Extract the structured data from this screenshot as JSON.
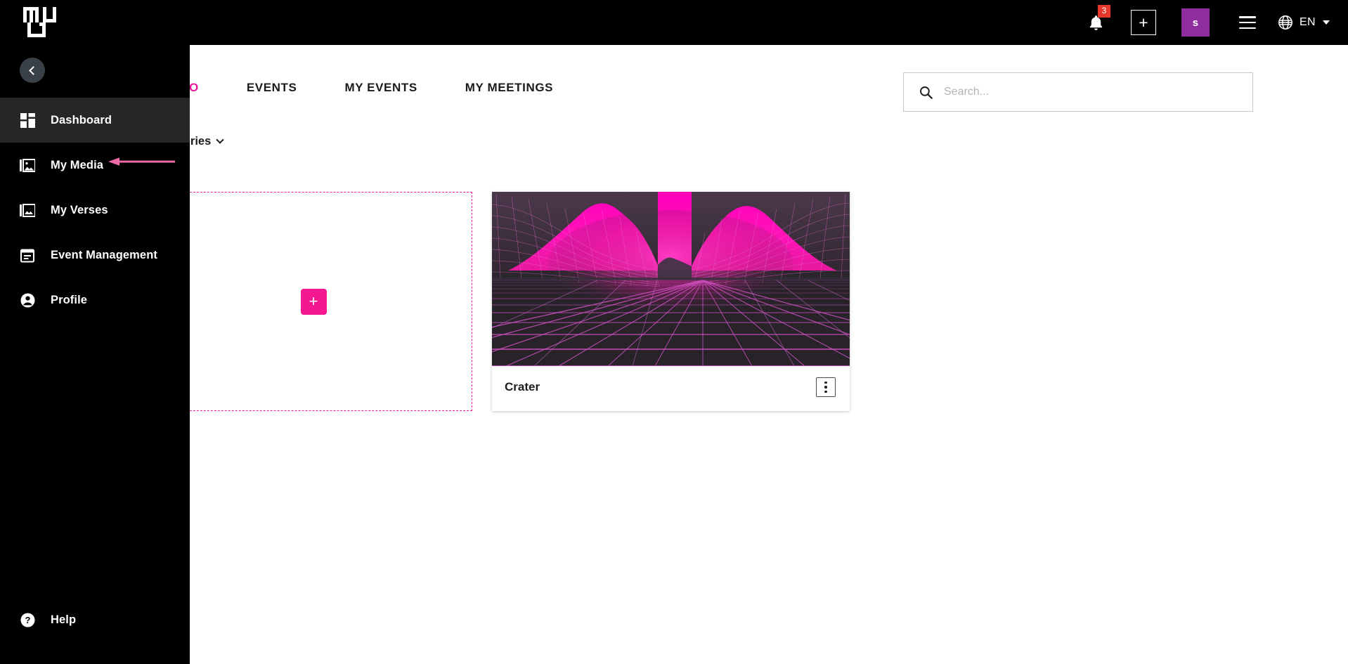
{
  "brand": {
    "logo_text": "MU",
    "accent_color": "#e8189b",
    "badge_color": "#e8382c",
    "avatar_color": "#8e2d9e"
  },
  "topbar": {
    "notifications": {
      "icon": "bell-icon",
      "count": "3"
    },
    "add": {
      "icon": "plus-icon",
      "label": "+"
    },
    "avatar": {
      "initial": "s"
    },
    "menu": {
      "icon": "hamburger-icon"
    },
    "language": {
      "icon": "globe-icon",
      "value": "EN",
      "caret": "chevron-down-icon"
    }
  },
  "sidebar": {
    "collapse": {
      "icon": "chevron-left-icon"
    },
    "items": [
      {
        "label": "Dashboard",
        "icon": "dashboard-icon",
        "active": true
      },
      {
        "label": "My Media",
        "icon": "media-image-icon",
        "active": false
      },
      {
        "label": "My Verses",
        "icon": "verses-image-icon",
        "active": false
      },
      {
        "label": "Event Management",
        "icon": "calendar-icon",
        "active": false
      },
      {
        "label": "Profile",
        "icon": "person-circle-icon",
        "active": false
      }
    ],
    "help": {
      "label": "Help",
      "icon": "help-circle-icon"
    }
  },
  "main": {
    "tabs": [
      {
        "label": "STUDIO",
        "active": true
      },
      {
        "label": "EVENTS",
        "active": false
      },
      {
        "label": "MY EVENTS",
        "active": false
      },
      {
        "label": "MY MEETINGS",
        "active": false
      }
    ],
    "search": {
      "placeholder": "Search...",
      "value": "",
      "icon": "search-icon"
    },
    "categories": {
      "label": "Categories",
      "caret": "chevron-down-icon"
    },
    "add_card": {
      "button_label": "+",
      "icon": "plus-icon"
    },
    "cards": [
      {
        "title": "Crater",
        "menu_icon": "kebab-menu-icon",
        "thumbnail": "synthwave-grid-landscape"
      }
    ]
  },
  "annotation": {
    "type": "arrow-left",
    "color": "#ef6ca8",
    "points_to": "My Media"
  }
}
